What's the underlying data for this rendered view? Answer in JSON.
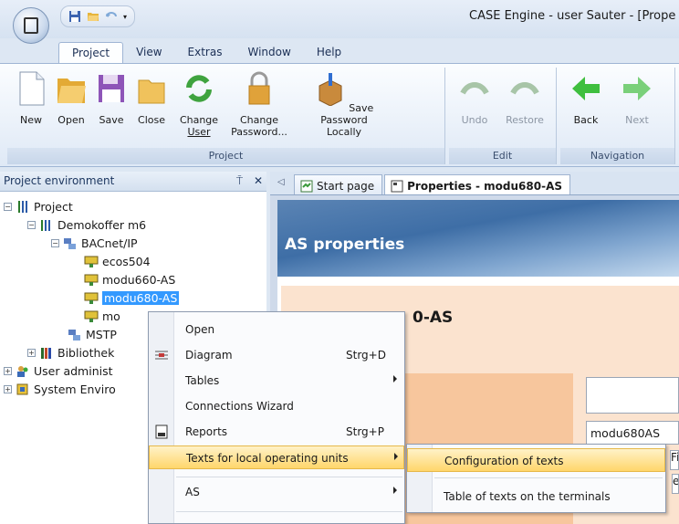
{
  "window": {
    "title": "CASE Engine - user Sauter - [Prope"
  },
  "ribbon_tabs": [
    "Project",
    "View",
    "Extras",
    "Window",
    "Help"
  ],
  "ribbon": {
    "groups": [
      {
        "label": "Project"
      },
      {
        "label": "Edit"
      },
      {
        "label": "Navigation"
      }
    ],
    "buttons": {
      "new": "New",
      "open": "Open",
      "save": "Save",
      "close": "Close",
      "change_user_1": "Change",
      "change_user_2": "User",
      "change_password_1": "Change",
      "change_password_2": "Password...",
      "save_password_1": "Save Password",
      "save_password_2": "Locally",
      "undo": "Undo",
      "restore": "Restore",
      "back": "Back",
      "next": "Next"
    }
  },
  "project_panel": {
    "title": "Project environment",
    "pin": "⍑",
    "close": "✕",
    "tree": [
      {
        "label": "Project"
      },
      {
        "label": "Demokoffer m6"
      },
      {
        "label": "BACnet/IP"
      },
      {
        "label": "ecos504"
      },
      {
        "label": "modu660-AS"
      },
      {
        "label": "modu680-AS"
      },
      {
        "label": "mo"
      },
      {
        "label": "MSTP"
      },
      {
        "label": "Bibliothek"
      },
      {
        "label": "User administ"
      },
      {
        "label": "System Enviro"
      }
    ]
  },
  "doc_tabs": [
    "Start page",
    "Properties - modu680-AS"
  ],
  "properties": {
    "banner_title": "AS properties",
    "heading_fragment": "0-AS",
    "field_value": "modu680AS",
    "partial_fi": "Fi",
    "partial_e": "e"
  },
  "context_menu": {
    "items": [
      {
        "label": "Open",
        "shortcut": ""
      },
      {
        "label": "Diagram",
        "shortcut": "Strg+D"
      },
      {
        "label": "Tables",
        "shortcut": ""
      },
      {
        "label": "Connections Wizard",
        "shortcut": ""
      },
      {
        "label": "Reports",
        "shortcut": "Strg+P"
      },
      {
        "label": "Texts for local operating units",
        "shortcut": ""
      },
      {
        "label": "AS",
        "shortcut": ""
      }
    ]
  },
  "submenu": {
    "items": [
      "Configuration of texts",
      "Table of texts on the terminals"
    ]
  },
  "colors": {
    "selection": "#3399ff",
    "highlight": "#ffd66b",
    "banner": "#3e6ea6"
  }
}
